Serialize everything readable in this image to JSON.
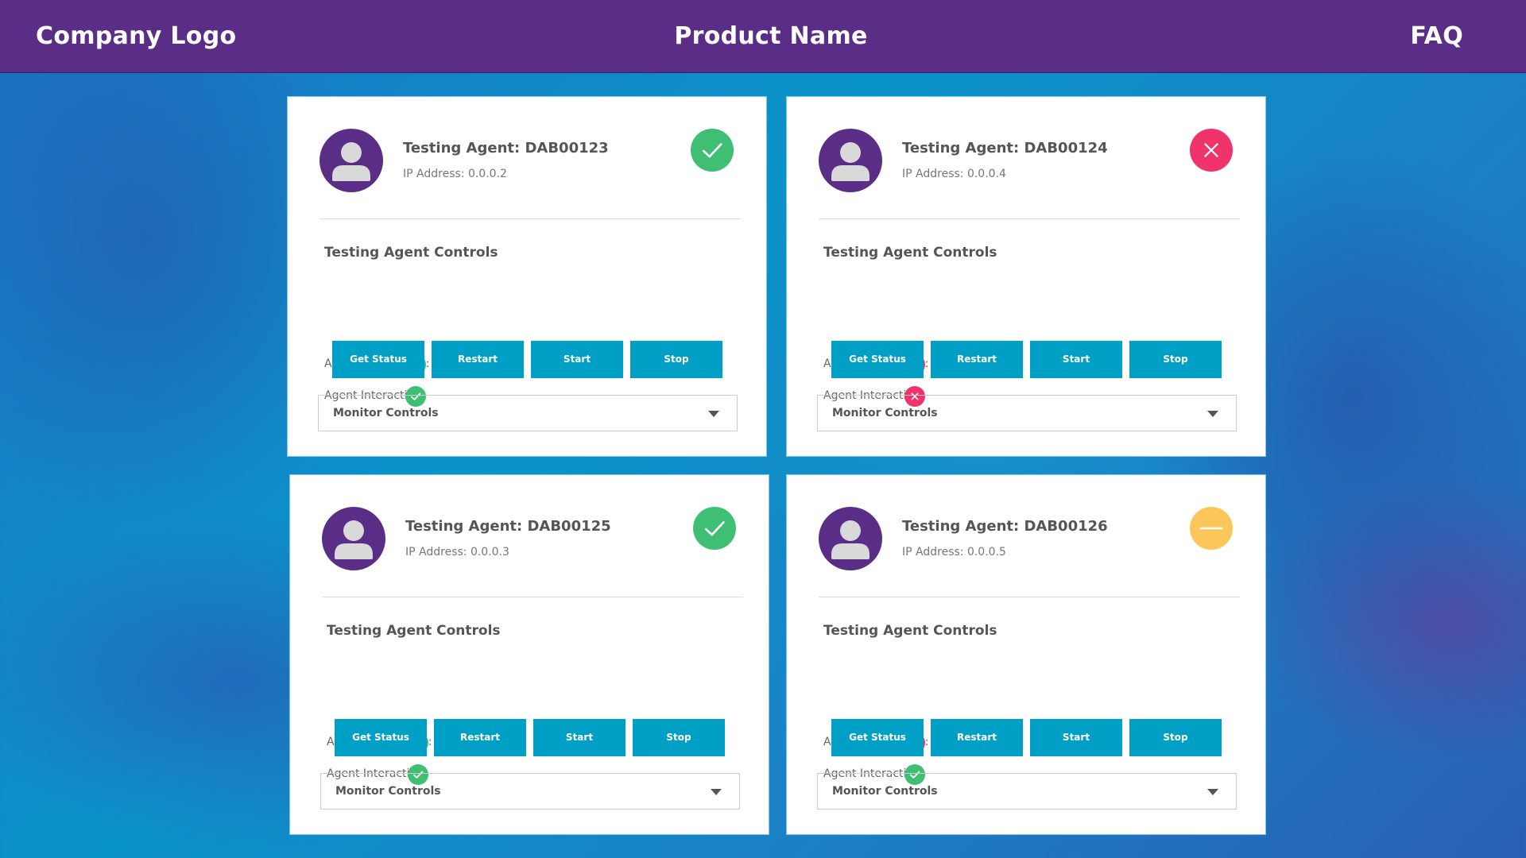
{
  "header": {
    "logo": "Company Logo",
    "product_name": "Product Name",
    "faq": "FAQ"
  },
  "colors": {
    "header_bg": "#5a2d86",
    "button_bg": "#00a0c6",
    "ok": "#3fbf74",
    "error": "#f0336b",
    "warning": "#fbc65a"
  },
  "agents": [
    {
      "name": "Testing Agent: DAB00123",
      "ip": "IP Address: 0.0.0.2",
      "status": "ok",
      "status_icon": "check-icon",
      "controls_title": "Testing Agent Controls",
      "responding_label": "Agent Responding:",
      "responding_status": "ok",
      "interactive_label": "Agent Interactive:",
      "interactive_status": "ok",
      "buttons": [
        "Get Status",
        "Restart",
        "Start",
        "Stop"
      ],
      "monitor_label": "Monitor Controls"
    },
    {
      "name": "Testing Agent: DAB00124",
      "ip": "IP Address: 0.0.0.4",
      "status": "error",
      "status_icon": "close-icon",
      "controls_title": "Testing Agent Controls",
      "responding_label": "Agent Responding:",
      "responding_status": "error",
      "interactive_label": "Agent Interactive:",
      "interactive_status": "error",
      "buttons": [
        "Get Status",
        "Restart",
        "Start",
        "Stop"
      ],
      "monitor_label": "Monitor Controls"
    },
    {
      "name": "Testing Agent: DAB00125",
      "ip": "IP Address: 0.0.0.3",
      "status": "ok",
      "status_icon": "check-icon",
      "controls_title": "Testing Agent Controls",
      "responding_label": "Agent Responding:",
      "responding_status": "ok",
      "interactive_label": "Agent Interactive:",
      "interactive_status": "ok",
      "buttons": [
        "Get Status",
        "Restart",
        "Start",
        "Stop"
      ],
      "monitor_label": "Monitor Controls"
    },
    {
      "name": "Testing Agent: DAB00126",
      "ip": "IP Address: 0.0.0.5",
      "status": "warning",
      "status_icon": "minus-icon",
      "controls_title": "Testing Agent Controls",
      "responding_label": "Agent Responding:",
      "responding_status": "error",
      "interactive_label": "Agent Interactive:",
      "interactive_status": "ok",
      "buttons": [
        "Get Status",
        "Restart",
        "Start",
        "Stop"
      ],
      "monitor_label": "Monitor Controls"
    }
  ]
}
